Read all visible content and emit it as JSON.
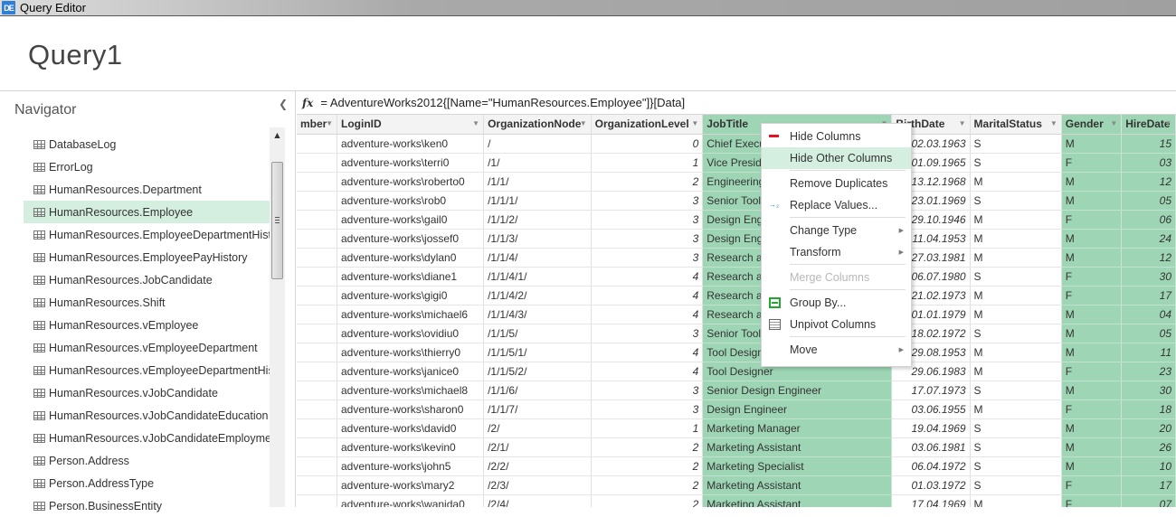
{
  "window": {
    "app_icon": "query-editor-app-icon",
    "title": "Query Editor"
  },
  "header": {
    "query_name": "Query1"
  },
  "navigator": {
    "title": "Navigator",
    "collapse_icon": "chevron-left-icon",
    "selected_index": 3,
    "items": [
      {
        "label": "DatabaseLog"
      },
      {
        "label": "ErrorLog"
      },
      {
        "label": "HumanResources.Department"
      },
      {
        "label": "HumanResources.Employee"
      },
      {
        "label": "HumanResources.EmployeeDepartmentHist..."
      },
      {
        "label": "HumanResources.EmployeePayHistory"
      },
      {
        "label": "HumanResources.JobCandidate"
      },
      {
        "label": "HumanResources.Shift"
      },
      {
        "label": "HumanResources.vEmployee"
      },
      {
        "label": "HumanResources.vEmployeeDepartment"
      },
      {
        "label": "HumanResources.vEmployeeDepartmentHis..."
      },
      {
        "label": "HumanResources.vJobCandidate"
      },
      {
        "label": "HumanResources.vJobCandidateEducation"
      },
      {
        "label": "HumanResources.vJobCandidateEmployment"
      },
      {
        "label": "Person.Address"
      },
      {
        "label": "Person.AddressType"
      },
      {
        "label": "Person.BusinessEntity"
      }
    ]
  },
  "formula_bar": {
    "fx_label": "fx",
    "formula": "= AdventureWorks2012{[Name=\"HumanResources.Employee\"]}[Data]"
  },
  "grid": {
    "columns": [
      {
        "name": "mber",
        "selected": false
      },
      {
        "name": "LoginID",
        "selected": false
      },
      {
        "name": "OrganizationNode",
        "selected": false
      },
      {
        "name": "OrganizationLevel",
        "selected": false
      },
      {
        "name": "JobTitle",
        "selected": true
      },
      {
        "name": "BirthDate",
        "selected": false
      },
      {
        "name": "MaritalStatus",
        "selected": false
      },
      {
        "name": "Gender",
        "selected": true
      },
      {
        "name": "HireDate",
        "selected": true
      }
    ],
    "rows": [
      [
        "",
        "adventure-works\\ken0",
        "/",
        "0",
        "Chief Executive Officer",
        "02.03.1963",
        "S",
        "M",
        "15"
      ],
      [
        "",
        "adventure-works\\terri0",
        "/1/",
        "1",
        "Vice President of Engineering",
        "01.09.1965",
        "S",
        "F",
        "03"
      ],
      [
        "",
        "adventure-works\\roberto0",
        "/1/1/",
        "2",
        "Engineering Manager",
        "13.12.1968",
        "M",
        "M",
        "12"
      ],
      [
        "",
        "adventure-works\\rob0",
        "/1/1/1/",
        "3",
        "Senior Tool Designer",
        "23.01.1969",
        "S",
        "M",
        "05"
      ],
      [
        "",
        "adventure-works\\gail0",
        "/1/1/2/",
        "3",
        "Design Engineer",
        "29.10.1946",
        "M",
        "F",
        "06"
      ],
      [
        "",
        "adventure-works\\jossef0",
        "/1/1/3/",
        "3",
        "Design Engineer",
        "11.04.1953",
        "M",
        "M",
        "24"
      ],
      [
        "",
        "adventure-works\\dylan0",
        "/1/1/4/",
        "3",
        "Research and Development Manager",
        "27.03.1981",
        "M",
        "M",
        "12"
      ],
      [
        "",
        "adventure-works\\diane1",
        "/1/1/4/1/",
        "4",
        "Research and Development Engineer",
        "06.07.1980",
        "S",
        "F",
        "30"
      ],
      [
        "",
        "adventure-works\\gigi0",
        "/1/1/4/2/",
        "4",
        "Research and Development Engineer",
        "21.02.1973",
        "M",
        "F",
        "17"
      ],
      [
        "",
        "adventure-works\\michael6",
        "/1/1/4/3/",
        "4",
        "Research and Development Manager",
        "01.01.1979",
        "M",
        "M",
        "04"
      ],
      [
        "",
        "adventure-works\\ovidiu0",
        "/1/1/5/",
        "3",
        "Senior Tool Designer",
        "18.02.1972",
        "S",
        "M",
        "05"
      ],
      [
        "",
        "adventure-works\\thierry0",
        "/1/1/5/1/",
        "4",
        "Tool Designer",
        "29.08.1953",
        "M",
        "M",
        "11"
      ],
      [
        "",
        "adventure-works\\janice0",
        "/1/1/5/2/",
        "4",
        "Tool Designer",
        "29.06.1983",
        "M",
        "F",
        "23"
      ],
      [
        "",
        "adventure-works\\michael8",
        "/1/1/6/",
        "3",
        "Senior Design Engineer",
        "17.07.1973",
        "S",
        "M",
        "30"
      ],
      [
        "",
        "adventure-works\\sharon0",
        "/1/1/7/",
        "3",
        "Design Engineer",
        "03.06.1955",
        "M",
        "F",
        "18"
      ],
      [
        "",
        "adventure-works\\david0",
        "/2/",
        "1",
        "Marketing Manager",
        "19.04.1969",
        "S",
        "M",
        "20"
      ],
      [
        "",
        "adventure-works\\kevin0",
        "/2/1/",
        "2",
        "Marketing Assistant",
        "03.06.1981",
        "S",
        "M",
        "26"
      ],
      [
        "",
        "adventure-works\\john5",
        "/2/2/",
        "2",
        "Marketing Specialist",
        "06.04.1972",
        "S",
        "M",
        "10"
      ],
      [
        "",
        "adventure-works\\mary2",
        "/2/3/",
        "2",
        "Marketing Assistant",
        "01.03.1972",
        "S",
        "F",
        "17"
      ],
      [
        "",
        "adventure-works\\wanida0",
        "/2/4/",
        "2",
        "Marketing Assistant",
        "17.04.1969",
        "M",
        "F",
        "07"
      ]
    ]
  },
  "context_menu": {
    "items": [
      {
        "label": "Hide Columns",
        "icon": "remove-column-icon"
      },
      {
        "label": "Hide Other Columns",
        "hover": true
      },
      {
        "label": "Remove Duplicates"
      },
      {
        "label": "Replace Values...",
        "icon": "replace-values-icon"
      },
      {
        "label": "Change Type",
        "submenu": true
      },
      {
        "label": "Transform",
        "submenu": true
      },
      {
        "label": "Merge Columns",
        "disabled": true
      },
      {
        "label": "Group By...",
        "icon": "group-by-icon"
      },
      {
        "label": "Unpivot Columns",
        "icon": "unpivot-icon"
      },
      {
        "label": "Move",
        "submenu": true
      }
    ]
  },
  "colors": {
    "selection_green": "#9ed5b5",
    "hover_green": "#d4eee0",
    "hide_icon_red": "#e81123",
    "group_icon_green": "#1fa82c"
  }
}
